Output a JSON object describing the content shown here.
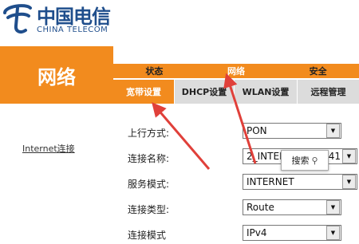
{
  "brand": {
    "name_cn": "中国电信",
    "name_en": "CHINA TELECOM"
  },
  "section": {
    "title": "网络"
  },
  "left_nav": {
    "link": "Internet连接"
  },
  "top_nav": [
    {
      "label": "状态",
      "active": false
    },
    {
      "label": "网络",
      "active": true
    },
    {
      "label": "安全",
      "active": false
    }
  ],
  "sub_nav": [
    {
      "label": "宽带设置",
      "active": true
    },
    {
      "label": "DHCP设置",
      "active": false
    },
    {
      "label": "WLAN设置",
      "active": false
    },
    {
      "label": "远程管理",
      "active": false
    }
  ],
  "form": {
    "uplink": {
      "label": "上行方式:",
      "value": "PON"
    },
    "conn_name": {
      "label": "连接名称:",
      "value": "2_INTER",
      "suffix": "D_41"
    },
    "service_mode": {
      "label": "服务模式:",
      "value": "INTERNET"
    },
    "conn_type": {
      "label": "连接类型:",
      "value": "Route"
    },
    "conn_mode": {
      "label": "连接模式",
      "value": "IPv4"
    }
  },
  "search_popup": {
    "label": "搜索",
    "icon": "search-icon"
  },
  "colors": {
    "accent": "#f28b1e",
    "subnav_bg": "#dcdcdc",
    "arrow": "#e0403a",
    "brand_blue": "#1f4e8c"
  }
}
